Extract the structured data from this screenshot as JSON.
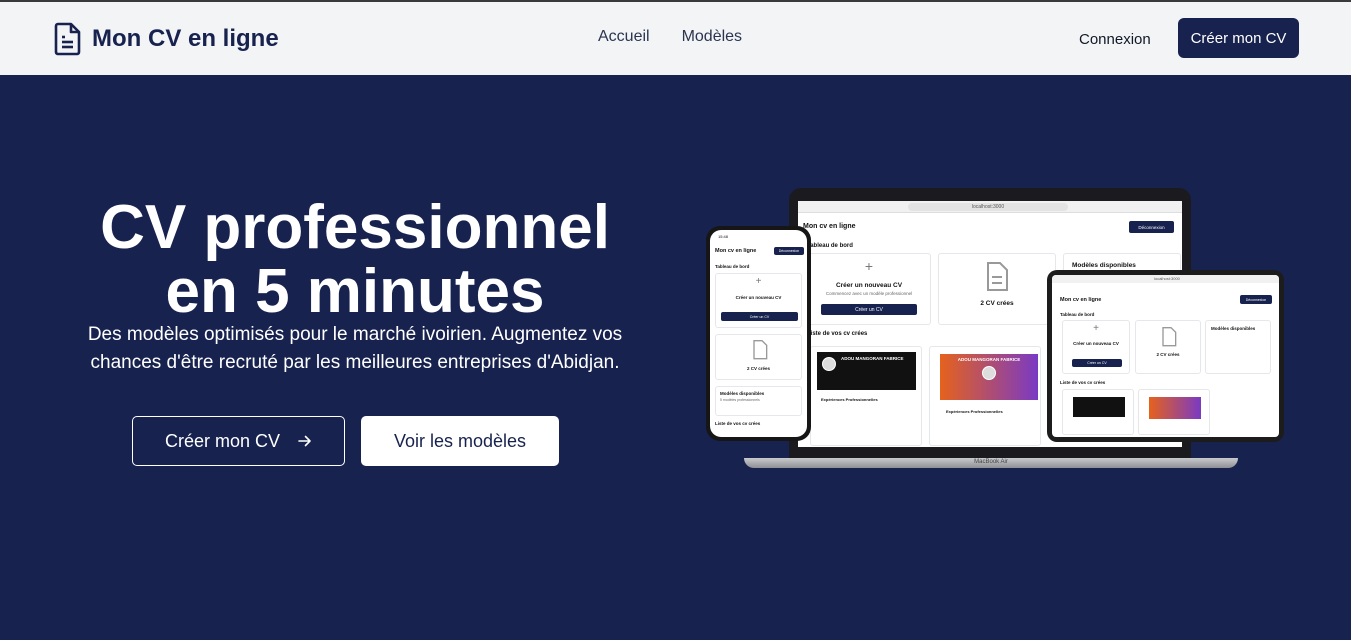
{
  "header": {
    "brand": "Mon CV en ligne",
    "nav": [
      "Accueil",
      "Modèles"
    ],
    "login": "Connexion",
    "cta": "Créer mon CV"
  },
  "hero": {
    "title_line1": "CV professionnel",
    "title_line2": "en 5 minutes",
    "subtitle_line1": "Des modèles optimisés pour le marché ivoirien. Augmentez vos",
    "subtitle_line2": "chances d'être recruté par les meilleures entreprises d'Abidjan.",
    "primary_button": "Créer mon CV",
    "secondary_button": "Voir les modèles"
  },
  "mockup": {
    "app_title": "Mon cv en ligne",
    "url": "localhost:3000",
    "logout": "Déconnexion",
    "dashboard": "Tableau de bord",
    "create_title": "Créer un nouveau CV",
    "create_sub": "Commencez avec un modèle professionnel",
    "create_button": "Créer un CV",
    "cv_count": "2 CV crées",
    "models_title": "Modèles disponibles",
    "models_sub": "5 modèles professionnels",
    "list_title": "Liste de vos cv crées",
    "cv_name": "ADOU MANGORAN FABRICE",
    "experience": "Expériences Professionnelles",
    "laptop_label": "MacBook Air",
    "phone_time": "15:48"
  },
  "colors": {
    "navy": "#17224f",
    "header_bg": "#f3f4f6"
  }
}
